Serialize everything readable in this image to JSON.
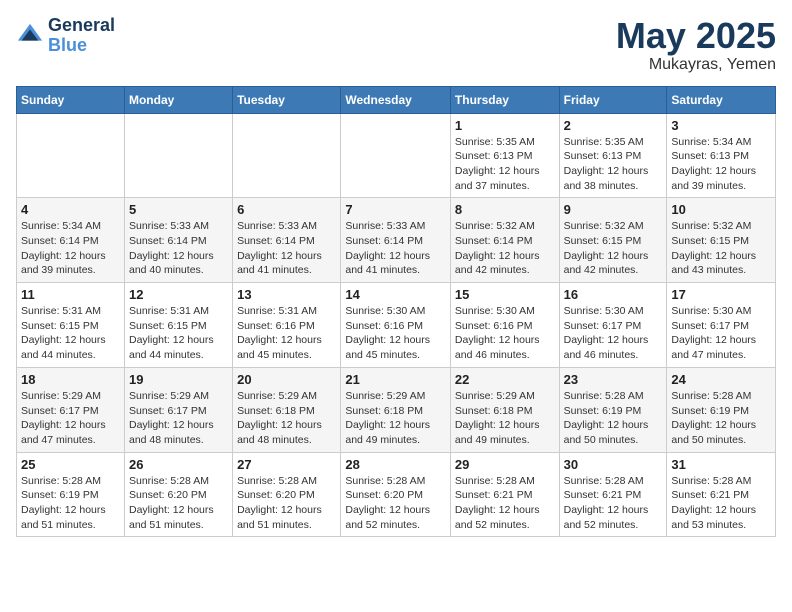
{
  "header": {
    "logo_line1": "General",
    "logo_line2": "Blue",
    "main_title": "May 2025",
    "sub_title": "Mukayras, Yemen"
  },
  "weekdays": [
    "Sunday",
    "Monday",
    "Tuesday",
    "Wednesday",
    "Thursday",
    "Friday",
    "Saturday"
  ],
  "weeks": [
    [
      {
        "day": "",
        "info": ""
      },
      {
        "day": "",
        "info": ""
      },
      {
        "day": "",
        "info": ""
      },
      {
        "day": "",
        "info": ""
      },
      {
        "day": "1",
        "info": "Sunrise: 5:35 AM\nSunset: 6:13 PM\nDaylight: 12 hours\nand 37 minutes."
      },
      {
        "day": "2",
        "info": "Sunrise: 5:35 AM\nSunset: 6:13 PM\nDaylight: 12 hours\nand 38 minutes."
      },
      {
        "day": "3",
        "info": "Sunrise: 5:34 AM\nSunset: 6:13 PM\nDaylight: 12 hours\nand 39 minutes."
      }
    ],
    [
      {
        "day": "4",
        "info": "Sunrise: 5:34 AM\nSunset: 6:14 PM\nDaylight: 12 hours\nand 39 minutes."
      },
      {
        "day": "5",
        "info": "Sunrise: 5:33 AM\nSunset: 6:14 PM\nDaylight: 12 hours\nand 40 minutes."
      },
      {
        "day": "6",
        "info": "Sunrise: 5:33 AM\nSunset: 6:14 PM\nDaylight: 12 hours\nand 41 minutes."
      },
      {
        "day": "7",
        "info": "Sunrise: 5:33 AM\nSunset: 6:14 PM\nDaylight: 12 hours\nand 41 minutes."
      },
      {
        "day": "8",
        "info": "Sunrise: 5:32 AM\nSunset: 6:14 PM\nDaylight: 12 hours\nand 42 minutes."
      },
      {
        "day": "9",
        "info": "Sunrise: 5:32 AM\nSunset: 6:15 PM\nDaylight: 12 hours\nand 42 minutes."
      },
      {
        "day": "10",
        "info": "Sunrise: 5:32 AM\nSunset: 6:15 PM\nDaylight: 12 hours\nand 43 minutes."
      }
    ],
    [
      {
        "day": "11",
        "info": "Sunrise: 5:31 AM\nSunset: 6:15 PM\nDaylight: 12 hours\nand 44 minutes."
      },
      {
        "day": "12",
        "info": "Sunrise: 5:31 AM\nSunset: 6:15 PM\nDaylight: 12 hours\nand 44 minutes."
      },
      {
        "day": "13",
        "info": "Sunrise: 5:31 AM\nSunset: 6:16 PM\nDaylight: 12 hours\nand 45 minutes."
      },
      {
        "day": "14",
        "info": "Sunrise: 5:30 AM\nSunset: 6:16 PM\nDaylight: 12 hours\nand 45 minutes."
      },
      {
        "day": "15",
        "info": "Sunrise: 5:30 AM\nSunset: 6:16 PM\nDaylight: 12 hours\nand 46 minutes."
      },
      {
        "day": "16",
        "info": "Sunrise: 5:30 AM\nSunset: 6:17 PM\nDaylight: 12 hours\nand 46 minutes."
      },
      {
        "day": "17",
        "info": "Sunrise: 5:30 AM\nSunset: 6:17 PM\nDaylight: 12 hours\nand 47 minutes."
      }
    ],
    [
      {
        "day": "18",
        "info": "Sunrise: 5:29 AM\nSunset: 6:17 PM\nDaylight: 12 hours\nand 47 minutes."
      },
      {
        "day": "19",
        "info": "Sunrise: 5:29 AM\nSunset: 6:17 PM\nDaylight: 12 hours\nand 48 minutes."
      },
      {
        "day": "20",
        "info": "Sunrise: 5:29 AM\nSunset: 6:18 PM\nDaylight: 12 hours\nand 48 minutes."
      },
      {
        "day": "21",
        "info": "Sunrise: 5:29 AM\nSunset: 6:18 PM\nDaylight: 12 hours\nand 49 minutes."
      },
      {
        "day": "22",
        "info": "Sunrise: 5:29 AM\nSunset: 6:18 PM\nDaylight: 12 hours\nand 49 minutes."
      },
      {
        "day": "23",
        "info": "Sunrise: 5:28 AM\nSunset: 6:19 PM\nDaylight: 12 hours\nand 50 minutes."
      },
      {
        "day": "24",
        "info": "Sunrise: 5:28 AM\nSunset: 6:19 PM\nDaylight: 12 hours\nand 50 minutes."
      }
    ],
    [
      {
        "day": "25",
        "info": "Sunrise: 5:28 AM\nSunset: 6:19 PM\nDaylight: 12 hours\nand 51 minutes."
      },
      {
        "day": "26",
        "info": "Sunrise: 5:28 AM\nSunset: 6:20 PM\nDaylight: 12 hours\nand 51 minutes."
      },
      {
        "day": "27",
        "info": "Sunrise: 5:28 AM\nSunset: 6:20 PM\nDaylight: 12 hours\nand 51 minutes."
      },
      {
        "day": "28",
        "info": "Sunrise: 5:28 AM\nSunset: 6:20 PM\nDaylight: 12 hours\nand 52 minutes."
      },
      {
        "day": "29",
        "info": "Sunrise: 5:28 AM\nSunset: 6:21 PM\nDaylight: 12 hours\nand 52 minutes."
      },
      {
        "day": "30",
        "info": "Sunrise: 5:28 AM\nSunset: 6:21 PM\nDaylight: 12 hours\nand 52 minutes."
      },
      {
        "day": "31",
        "info": "Sunrise: 5:28 AM\nSunset: 6:21 PM\nDaylight: 12 hours\nand 53 minutes."
      }
    ]
  ]
}
